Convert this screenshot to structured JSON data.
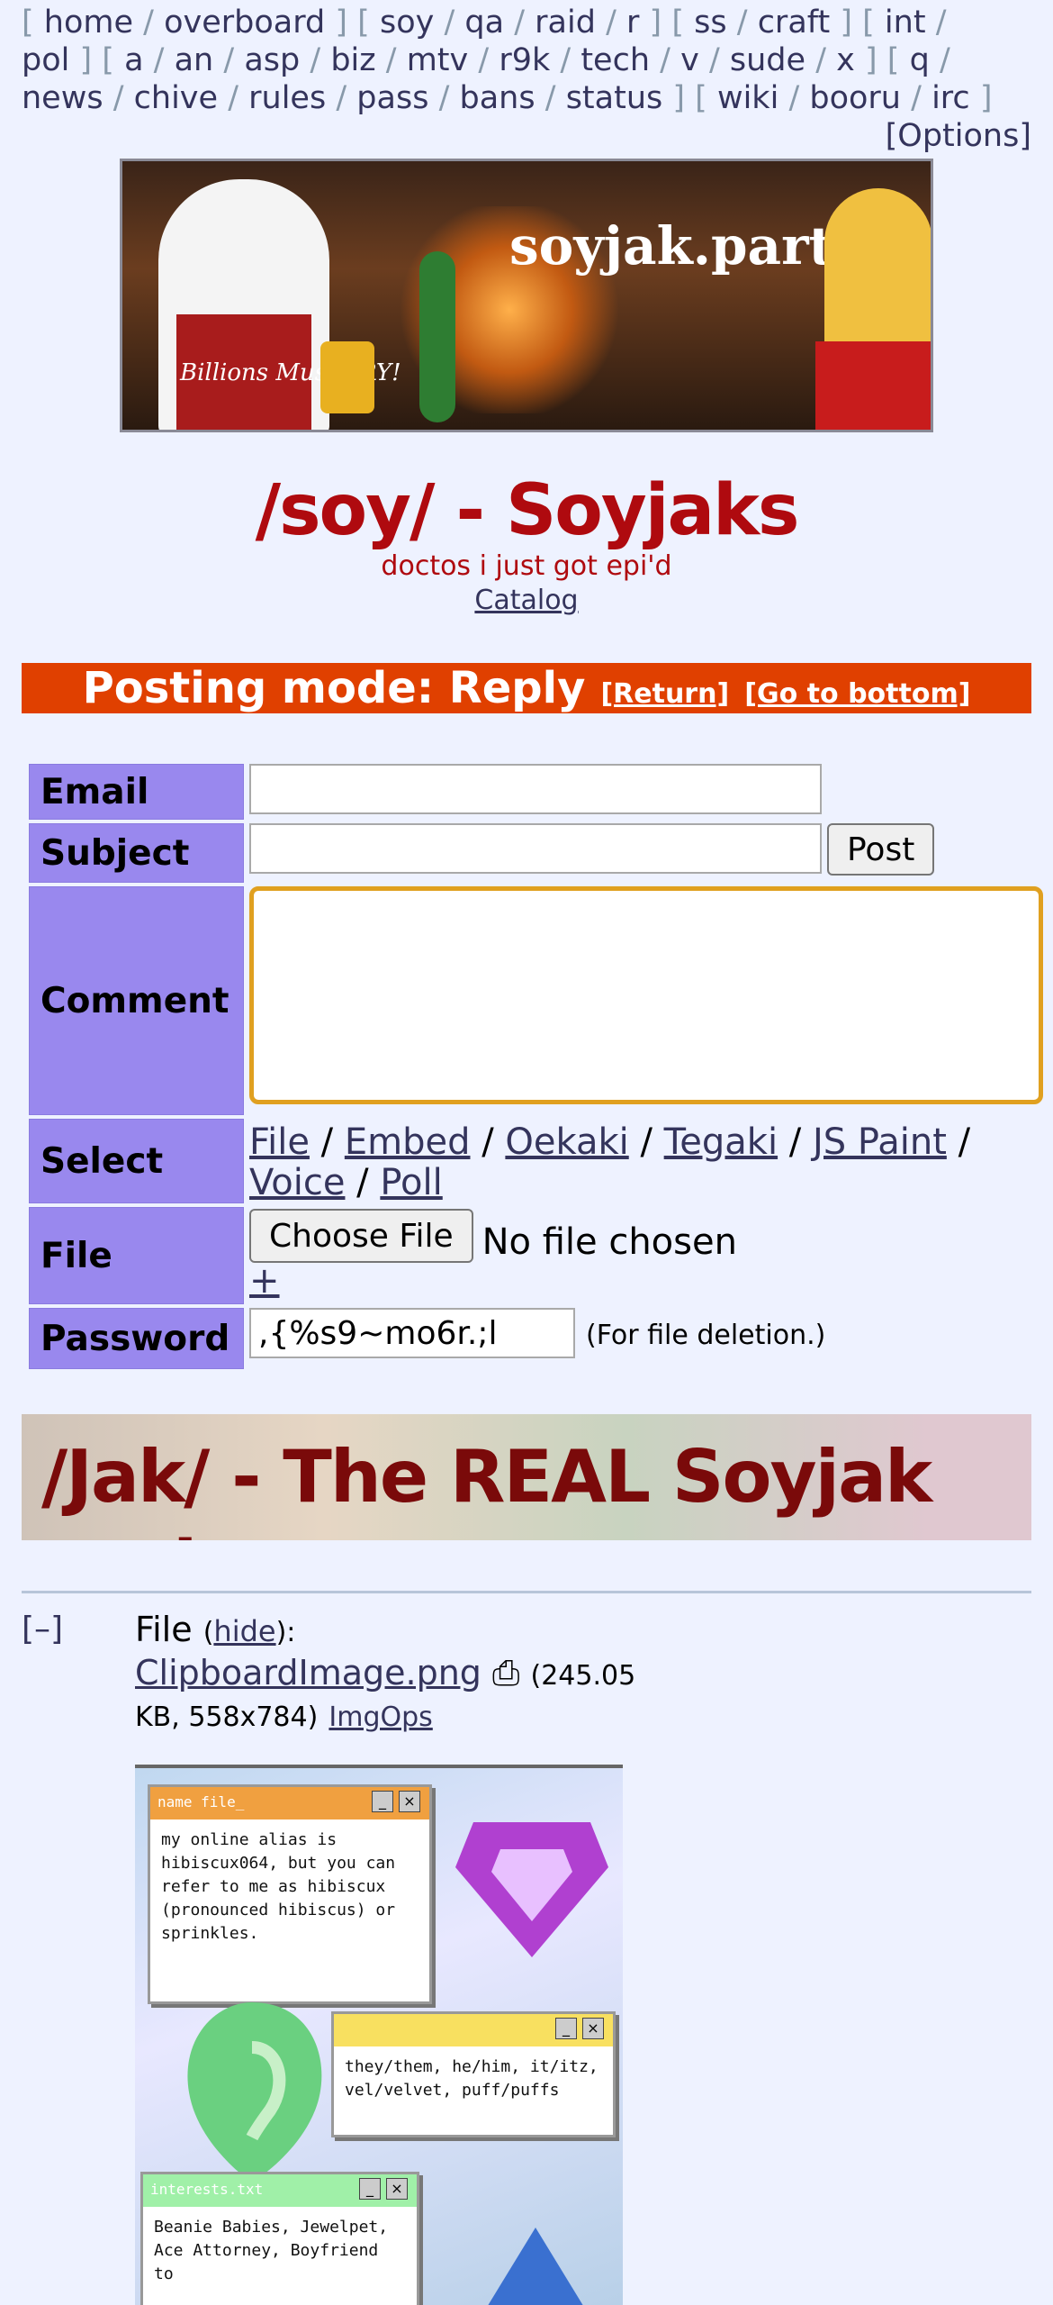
{
  "boardlist": {
    "row1": [
      "home",
      "overboard",
      "soy",
      "qa",
      "raid",
      "r",
      "ss",
      "craft",
      "int"
    ],
    "row2": [
      "pol",
      "a",
      "an",
      "asp",
      "biz",
      "mtv",
      "r9k",
      "tech",
      "v",
      "sude",
      "x",
      "q"
    ],
    "row3": [
      "news",
      "chive",
      "rules",
      "pass",
      "bans",
      "status",
      "wiki",
      "booru",
      "irc"
    ],
    "options": "[Options]"
  },
  "banner": {
    "site_name": "soyjak.party",
    "apron_text": "Billions Must TRY!"
  },
  "board": {
    "title": "/soy/ - Soyjaks",
    "subtitle": "doctos i just got epi'd",
    "catalog": "Catalog"
  },
  "mode": {
    "label": "Posting mode: Reply",
    "return": "[Return]",
    "bottom": "[Go to bottom]"
  },
  "form": {
    "email_label": "Email",
    "subject_label": "Subject",
    "comment_label": "Comment",
    "select_label": "Select",
    "file_label": "File",
    "password_label": "Password",
    "post_button": "Post",
    "email_value": "",
    "subject_value": "",
    "select_options": [
      "File",
      "Embed",
      "Oekaki",
      "Tegaki",
      "JS Paint",
      "Voice",
      "Poll"
    ],
    "choose_file": "Choose File",
    "no_file": "No file chosen",
    "add_file": "+",
    "password_value": ",{%s9~mo6r.;l",
    "password_hint": "(For file deletion.)"
  },
  "ad": {
    "text": "/Jak/ - The REAL Soyjak party"
  },
  "thread": {
    "toggle": "[–]",
    "file_label": "File",
    "hide": "hide",
    "filename": "ClipboardImage.png",
    "download_icon": "download-icon",
    "size_prefix": "(245.05",
    "size_rest": "KB, 558x784)",
    "imgops": "ImgOps",
    "thumb": {
      "win1_text": "my online alias is hibiscux064, but you can refer to me as hibiscux (pronounced hibiscus) or sprinkles.",
      "win1_title": "name file_",
      "win2_text": "they/them, he/him, it/itz, vel/velvet, puff/puffs",
      "win3_title": "interests.txt",
      "win3_text": "Beanie Babies, Jewelpet, Ace Attorney, Boyfriend to"
    }
  },
  "colors": {
    "background": "#eef2ff",
    "title_red": "#af0a0f",
    "mode_orange": "#e04000",
    "label_purple": "#9988ee",
    "link": "#34345c"
  }
}
